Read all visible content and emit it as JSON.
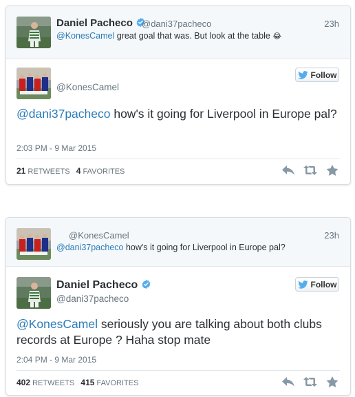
{
  "tweet1": {
    "parent": {
      "name": "Daniel Pacheco",
      "handle": "@dani37pacheco",
      "time": "23h",
      "mention": "@KonesCamel",
      "text": " great goal that was. But look at the table ",
      "emoji": "😂"
    },
    "main": {
      "handle": "@KonesCamel",
      "follow_label": "Follow",
      "mention": "@dani37pacheco",
      "text": " how's it going for Liverpool in Europe pal?",
      "date": "2:03 PM - 9 Mar 2015",
      "retweets": "21",
      "retweets_label": "RETWEETS",
      "favorites": "4",
      "favorites_label": "FAVORITES"
    }
  },
  "tweet2": {
    "parent": {
      "handle": "@KonesCamel",
      "time": "23h",
      "mention": "@dani37pacheco",
      "text": " how's it going for Liverpool in Europe pal?"
    },
    "main": {
      "name": "Daniel Pacheco",
      "handle": "@dani37pacheco",
      "follow_label": "Follow",
      "mention": "@KonesCamel",
      "text": " seriously you are talking about both clubs records at Europe ? Haha stop mate",
      "date": "2:04 PM - 9 Mar 2015",
      "retweets": "402",
      "retweets_label": "RETWEETS",
      "favorites": "415",
      "favorites_label": "FAVORITES"
    }
  },
  "icons": {
    "verified": "verified-badge-icon",
    "bird": "twitter-bird-icon",
    "reply": "reply-icon",
    "retweet": "retweet-icon",
    "favorite": "favorite-star-icon"
  },
  "colors": {
    "link": "#2b7bb9",
    "verified": "#55acee",
    "bird": "#55acee",
    "action": "#8899a6"
  }
}
